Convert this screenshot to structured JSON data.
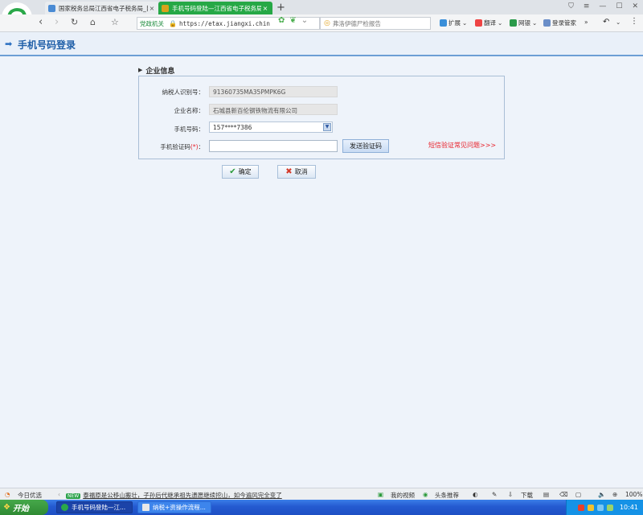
{
  "browser": {
    "tabs": [
      {
        "title": "国家税务总局江西省电子税务局_目",
        "close": "×"
      },
      {
        "title": "手机号码登陆—江西省电子税务局",
        "close": "×"
      }
    ],
    "new_tab": "+",
    "address": {
      "badge": "党政机关",
      "url": "https://etax.jiangxi.chin"
    },
    "search_placeholder": "弗洛伊德尸检报告",
    "toolbar": {
      "extensions": "扩展",
      "translate": "翻译",
      "netbank": "网银",
      "login_manager": "登录管家",
      "more": "»"
    }
  },
  "page": {
    "title": "手机号码登录",
    "section_title": "企业信息",
    "fields": {
      "taxpayer_id_label": "纳税人识别号：",
      "taxpayer_id_value": "91360735MA35PMPK6G",
      "company_label": "企业名称：",
      "company_value": "石城县新百伦钢铁物流有限公司",
      "phone_label": "手机号码：",
      "phone_value": "157****7386",
      "code_label": "手机验证码",
      "code_required": "(*)",
      "code_label_colon": "："
    },
    "send_code_button": "发送验证码",
    "faq_link": "短信验证常见问题>>>",
    "confirm_button": "确定",
    "cancel_button": "取消"
  },
  "statusbar": {
    "today": "今日优选",
    "news_badge": "NEW",
    "news": "泰福原是公移山搬壮，子孙后代继承祖先遗愿继续挖山，如今遍风完全变了",
    "my_video": "我的视频",
    "headline": "头条推荐",
    "download": "下载",
    "zoom": "100%"
  },
  "taskbar": {
    "start": "开始",
    "task1": "手机号码登陆—江...",
    "task2": "纳税+资操作流程...",
    "clock": "10:41"
  },
  "colors": {
    "active_tab": "#26a846",
    "header_title": "#1f5fa8",
    "faq_link": "#e8202a"
  }
}
